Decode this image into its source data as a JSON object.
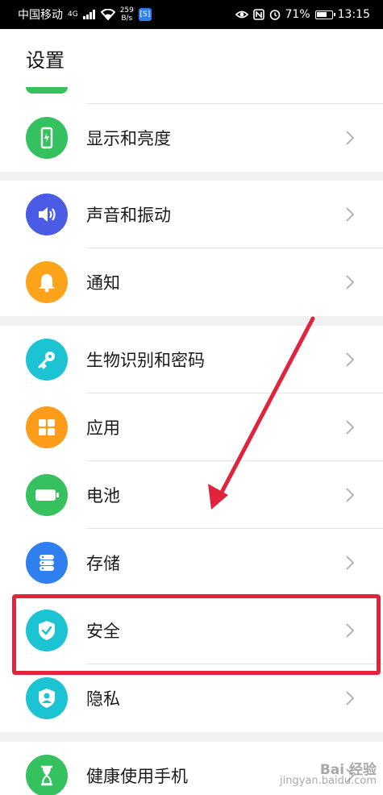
{
  "status_bar": {
    "carrier": "中国移动",
    "network": "4G",
    "speed_value": "259",
    "speed_unit": "B/s",
    "app_badge": "[S]",
    "battery": "71%",
    "time": "13:15"
  },
  "header": {
    "title": "设置"
  },
  "settings": {
    "items": [
      {
        "label": "显示和亮度",
        "icon": "phone-brightness-icon",
        "color": "#35c25e"
      },
      {
        "label": "声音和振动",
        "icon": "speaker-icon",
        "color": "#4a5ce6"
      },
      {
        "label": "通知",
        "icon": "bell-icon",
        "color": "#ffa31a"
      },
      {
        "label": "生物识别和密码",
        "icon": "key-icon",
        "color": "#1cc4d3"
      },
      {
        "label": "应用",
        "icon": "apps-grid-icon",
        "color": "#ff9c1a"
      },
      {
        "label": "电池",
        "icon": "battery-icon",
        "color": "#35c25e"
      },
      {
        "label": "存储",
        "icon": "storage-icon",
        "color": "#2f7ff0"
      },
      {
        "label": "安全",
        "icon": "shield-check-icon",
        "color": "#1cc4d3"
      },
      {
        "label": "隐私",
        "icon": "privacy-shield-icon",
        "color": "#1cc4d3"
      },
      {
        "label": "健康使用手机",
        "icon": "hourglass-icon",
        "color": "#35c25e"
      }
    ]
  },
  "annotation": {
    "highlight_color": "#e2233c"
  },
  "watermark": {
    "line1": "Bai",
    "line2": "经验",
    "line3": "jingyan.baidu.com"
  }
}
